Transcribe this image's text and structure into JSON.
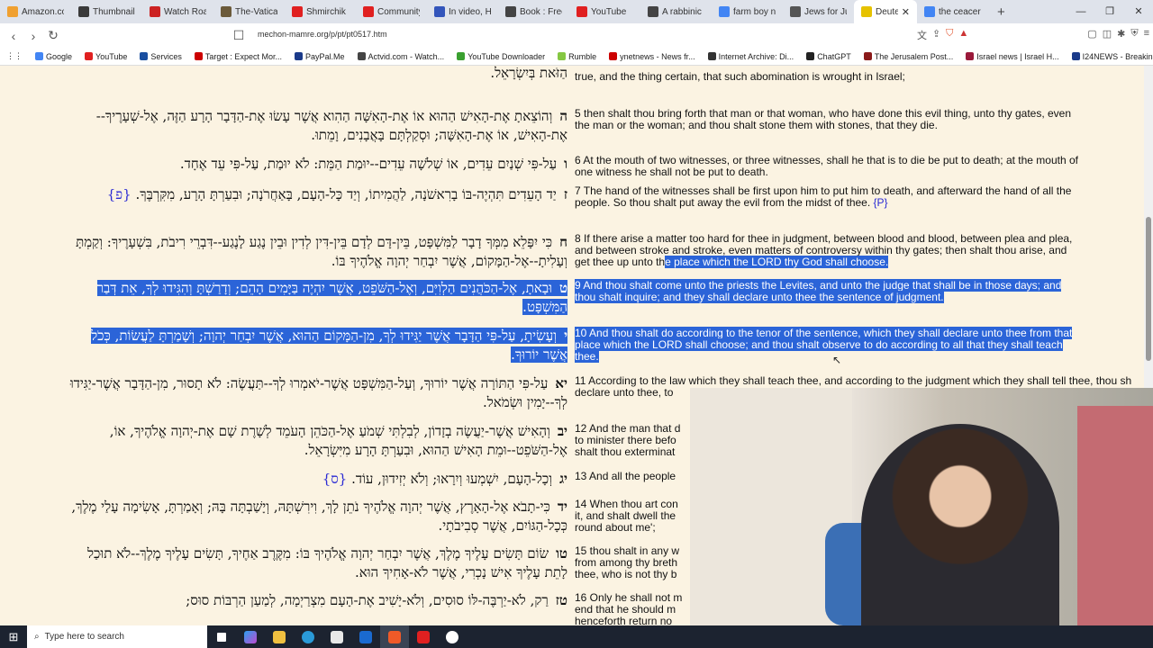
{
  "tabs": [
    {
      "label": "Amazon.com",
      "color": "#f0a030"
    },
    {
      "label": "Thumbnail c",
      "color": "#3a3a3a"
    },
    {
      "label": "Watch Roar",
      "color": "#cc2222"
    },
    {
      "label": "The-Vatican-f",
      "color": "#6b5a3a"
    },
    {
      "label": "Shmirchik Ku",
      "color": "#e02020"
    },
    {
      "label": "Community -",
      "color": "#e02020"
    },
    {
      "label": "In video, Han",
      "color": "#3355bb"
    },
    {
      "label": "Book : Free D",
      "color": "#444444"
    },
    {
      "label": "YouTube",
      "color": "#e02020"
    },
    {
      "label": "A rabbinic co",
      "color": "#444444"
    },
    {
      "label": "farm boy nan",
      "color": "#4285f4"
    },
    {
      "label": "Jews for Juda",
      "color": "#555555"
    },
    {
      "label": "Deutero",
      "color": "#e6c200",
      "active": true
    },
    {
      "label": "the ceacer wi",
      "color": "#4285f4"
    }
  ],
  "address": {
    "url": "mechon-mamre.org/p/pt/pt0517.htm"
  },
  "bookmarks": [
    {
      "label": "Google",
      "color": "#4285f4"
    },
    {
      "label": "YouTube",
      "color": "#e02020"
    },
    {
      "label": "Services",
      "color": "#1a4fa0"
    },
    {
      "label": "Target : Expect Mor...",
      "color": "#cc0000"
    },
    {
      "label": "PayPal.Me",
      "color": "#1a3a8a"
    },
    {
      "label": "Actvid.com - Watch...",
      "color": "#444444"
    },
    {
      "label": "YouTube Downloader",
      "color": "#3aa030"
    },
    {
      "label": "Rumble",
      "color": "#85c742"
    },
    {
      "label": "ynetnews - News fr...",
      "color": "#cc0000"
    },
    {
      "label": "Internet Archive: Di...",
      "color": "#333333"
    },
    {
      "label": "ChatGPT",
      "color": "#222222"
    },
    {
      "label": "The Jerusalem Post...",
      "color": "#8a1a1a"
    },
    {
      "label": "Israel news | Israel H...",
      "color": "#9a1a3a"
    },
    {
      "label": "I24NEWS - Breaking...",
      "color": "#1a3a8a"
    }
  ],
  "hebrew": [
    {
      "text": "וְהוֹצֵאתָ אֶת-הָאִישׁ הַהוּא אוֹ אֶת-הָאִשָּׁה הַהִוא אֲשֶׁר עָשׂוּ אֶת-הַדָּבָר הָרָע הַזֶּה, אֶל-שְׁעָרֶיךָ--אֶת-הָאִישׁ, אוֹ אֶת-הָאִשָּׁה; וּסְקַלְתָּם בָּאֲבָנִים, וָמֵתוּ.",
      "num": "ה"
    },
    {
      "text": "עַל-פִּי שְׁנַיִם עֵדִים, אוֹ שְׁלֹשָׁה עֵדִים--יוּמַת הַמֵּת: לֹא יוּמַת, עַל-פִּי עֵד אֶחָד.",
      "num": "ו"
    },
    {
      "text": "יַד הָעֵדִים תִּהְיֶה-בּוֹ בָרִאשֹׁנָה, לַהֲמִיתוֹ, וְיַד כָּל-הָעָם, בָּאַחֲרֹנָה; וּבִעַרְתָּ הָרָע, מִקִּרְבֶּךָ.",
      "num": "ז",
      "mark": "{פ}"
    },
    {
      "text": "כִּי יִפָּלֵא מִמְּךָ דָבָר לַמִּשְׁפָּט, בֵּין-דָּם לְדָם בֵּין-דִּין לְדִין וּבֵין נֶגַע לָנֶגַע--דִּבְרֵי רִיבֹת, בִּשְׁעָרֶיךָ: וְקַמְתָּ וְעָלִיתָ--אֶל-הַמָּקוֹם, אֲשֶׁר יִבְחַר יְהוָה אֱלֹהֶיךָ בּוֹ.",
      "num": "ח"
    },
    {
      "text": "וּבָאתָ, אֶל-הַכֹּהֲנִים הַלְוִיִּם, וְאֶל-הַשֹּׁפֵט, אֲשֶׁר יִהְיֶה בַּיָּמִים הָהֵם; וְדָרַשְׁתָּ וְהִגִּידוּ לְךָ, אֵת דְּבַר הַמִּשְׁפָּט.",
      "num": "ט"
    },
    {
      "text": "וְעָשִׂיתָ, עַל-פִּי הַדָּבָר אֲשֶׁר יַגִּידוּ לְךָ, מִן-הַמָּקוֹם הַהוּא, אֲשֶׁר יִבְחַר יְהוָה; וְשָׁמַרְתָּ לַעֲשׂוֹת, כְּכֹל אֲשֶׁר יוֹרוּךָ.",
      "num": "י"
    },
    {
      "text": "עַל-פִּי הַתּוֹרָה אֲשֶׁר יוֹרוּךָ, וְעַל-הַמִּשְׁפָּט אֲשֶׁר-יֹאמְרוּ לְךָ--תַּעֲשֶׂה: לֹא תָסוּר, מִן-הַדָּבָר אֲשֶׁר-יַגִּידוּ לְךָ--יָמִין וּשְׂמֹאל.",
      "num": "יא"
    },
    {
      "text": "וְהָאִישׁ אֲשֶׁר-יַעֲשֶׂה בְזָדוֹן, לְבִלְתִּי שְׁמֹעַ אֶל-הַכֹּהֵן הָעֹמֵד לְשָׁרֶת שָׁם אֶת-יְהוָה אֱלֹהֶיךָ, אוֹ, אֶל-הַשֹּׁפֵט--וּמֵת הָאִישׁ הַהוּא, וּבִעַרְתָּ הָרָע מִיִּשְׂרָאֵל.",
      "num": "יב"
    },
    {
      "text": "וְכָל-הָעָם, יִשְׁמְעוּ וְיִרָאוּ; וְלֹא יְזִידוּן, עוֹד.",
      "num": "יג",
      "mark": "{ס}"
    },
    {
      "text": "כִּי-תָבֹא אֶל-הָאָרֶץ, אֲשֶׁר יְהוָה אֱלֹהֶיךָ נֹתֵן לָךְ, וִירִשְׁתָּהּ, וְיָשַׁבְתָּה בָּהּ; וְאָמַרְתָּ, אָשִׂימָה עָלַי מֶלֶךְ, כְּכָל-הַגּוֹיִם, אֲשֶׁר סְבִיבֹתָי.",
      "num": "יד"
    },
    {
      "text": "שׂוֹם תָּשִׂים עָלֶיךָ מֶלֶךְ, אֲשֶׁר יִבְחַר יְהוָה אֱלֹהֶיךָ בּוֹ: מִקֶּרֶב אַחֶיךָ, תָּשִׂים עָלֶיךָ מֶלֶךְ--לֹא תוּכַל לָתֵת עָלֶיךָ אִישׁ נָכְרִי, אֲשֶׁר לֹא-אָחִיךָ הוּא.",
      "num": "טו"
    },
    {
      "text": "רַק, לֹא-יַרְבֶּה-לּוֹ סוּסִים, וְלֹא-יָשִׁיב אֶת-הָעָם מִצְרַיְמָה, לְמַעַן הַרְבּוֹת סוּס;",
      "num": "טז"
    }
  ],
  "english": {
    "v4_tail": "true, and the thing certain, that such abomination is wrought in Israel;",
    "v5": "5 then shalt thou bring forth that man or that woman, who have done this evil thing, unto thy gates, even the man or the woman; and thou shalt stone them with stones, that they die.",
    "v6": "6 At the mouth of two witnesses, or three witnesses, shall he that is to die be put to death; at the mouth of one witness he shall not be put to death.",
    "v7": "7 The hand of the witnesses shall be first upon him to put him to death, and afterward the hand of all the people. So thou shalt put away the evil from the midst of thee.",
    "v7_mark": "{P}",
    "v8_a": "8 If there arise a matter too hard for thee in judgment, between blood and blood, between plea and plea, and between stroke and stroke, even matters of controversy within thy gates; then shalt thou arise, and get thee up unto th",
    "v8_b": "e place which the LORD thy God shall choose.",
    "v9": "9 And thou shalt come unto the priests the Levites, and unto the judge that shall be in those days; and thou shalt inquire; and they shall declare unto thee the sentence of judgment.",
    "v10": "10 And thou shalt do according to the tenor of the sentence, which they shall declare unto thee from that place which the LORD shall choose; and thou shalt observe to do according to all that they shall teach thee.",
    "v11": "11 According to the law which they shall teach thee, and according to the judgment which they shall tell thee, thou sh",
    "v11_b": "declare unto thee, to",
    "v12": "12 And the man that d",
    "v12_b": "to minister there befo",
    "v12_c": "shalt thou exterminat",
    "v13": "13 And all the people",
    "v14": "14 When thou art con",
    "v14_b": "it, and shalt dwell the",
    "v14_c": "round about me';",
    "v15": "15 thou shalt in any w",
    "v15_b": "from among thy breth",
    "v15_c": "thee, who is not thy b",
    "v16": "16 Only he shall not m",
    "v16_b": "end that he should m",
    "v16_c": "henceforth return no"
  },
  "heb_top_partial": "הַזֹּאת בְּיִשְׂרָאֵל.",
  "taskbar": {
    "search_placeholder": "Type here to search"
  }
}
